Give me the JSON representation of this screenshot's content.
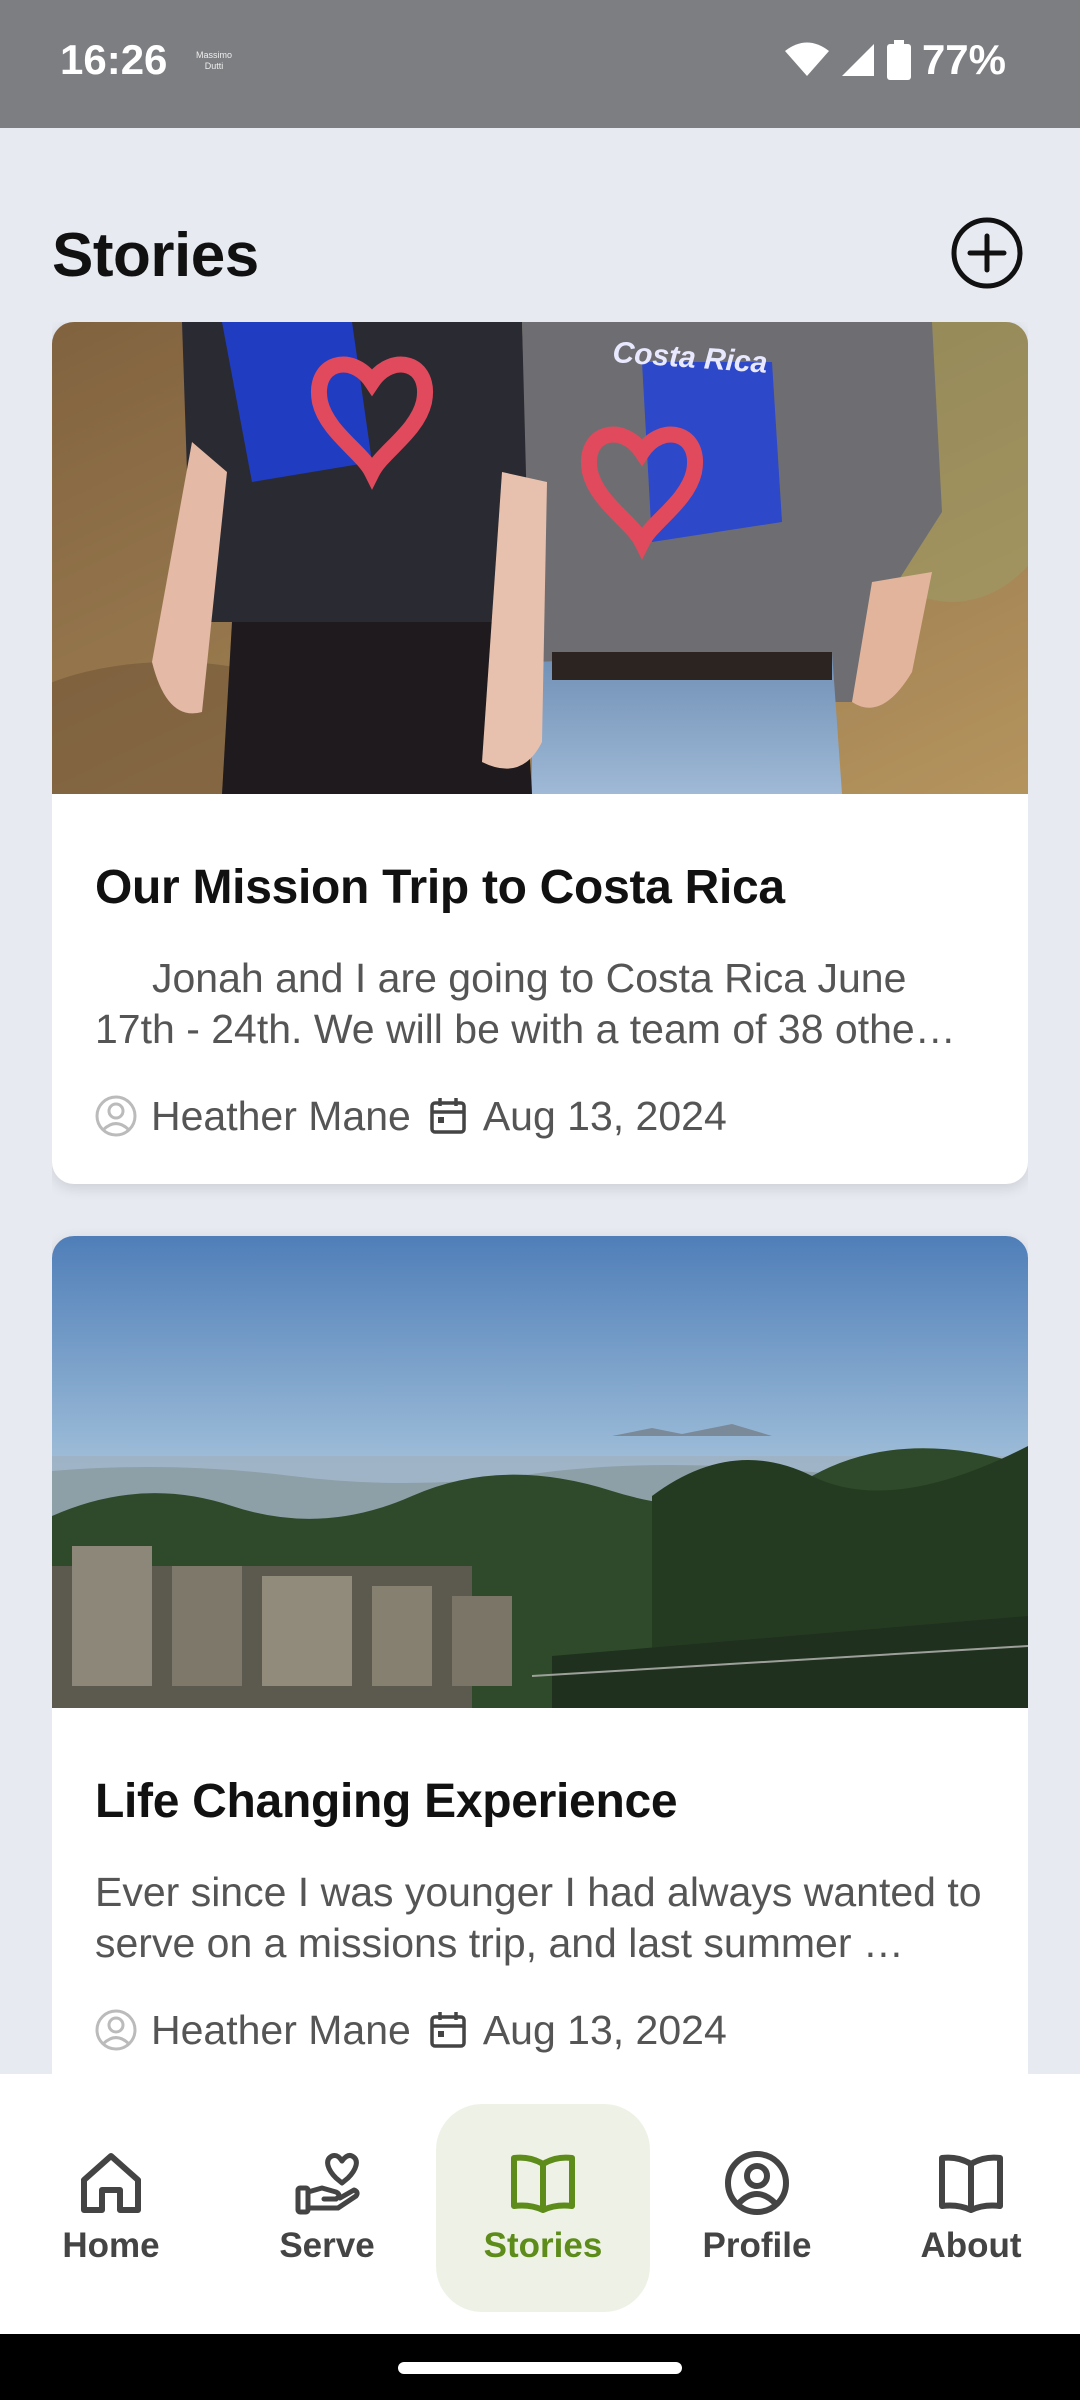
{
  "status_bar": {
    "time": "16:26",
    "mini_label_line1": "Massimo",
    "mini_label_line2": "Dutti",
    "battery_percent": "77%",
    "icons": [
      "wifi-icon",
      "signal-icon",
      "battery-icon"
    ]
  },
  "header": {
    "title": "Stories",
    "add_icon": "plus-circle-icon"
  },
  "stories": [
    {
      "title": "Our Mission Trip to Costa Rica",
      "excerpt": "     Jonah and I are going to Costa Rica June 17th - 24th. We will be with a team of 38 othe…",
      "author": "Heather Mane",
      "date": "Aug 13, 2024",
      "image_text": "Costa Rica"
    },
    {
      "title": "Life Changing Experience",
      "excerpt": "Ever since I was younger I had always wanted to serve on a missions trip, and last summer …",
      "author": "Heather Mane",
      "date": "Aug 13, 2024"
    }
  ],
  "bottom_nav": {
    "items": [
      {
        "label": "Home",
        "icon": "home-icon",
        "active": false
      },
      {
        "label": "Serve",
        "icon": "hand-heart-icon",
        "active": false
      },
      {
        "label": "Stories",
        "icon": "book-open-icon",
        "active": true
      },
      {
        "label": "Profile",
        "icon": "user-circle-icon",
        "active": false
      },
      {
        "label": "About",
        "icon": "book-open-icon",
        "active": false
      }
    ],
    "active_color": "#5e8c1a",
    "active_background": "#eef2e6"
  },
  "colors": {
    "background": "#e8eaf2",
    "status_bar": "#7d7e82",
    "text_secondary": "#555555"
  }
}
